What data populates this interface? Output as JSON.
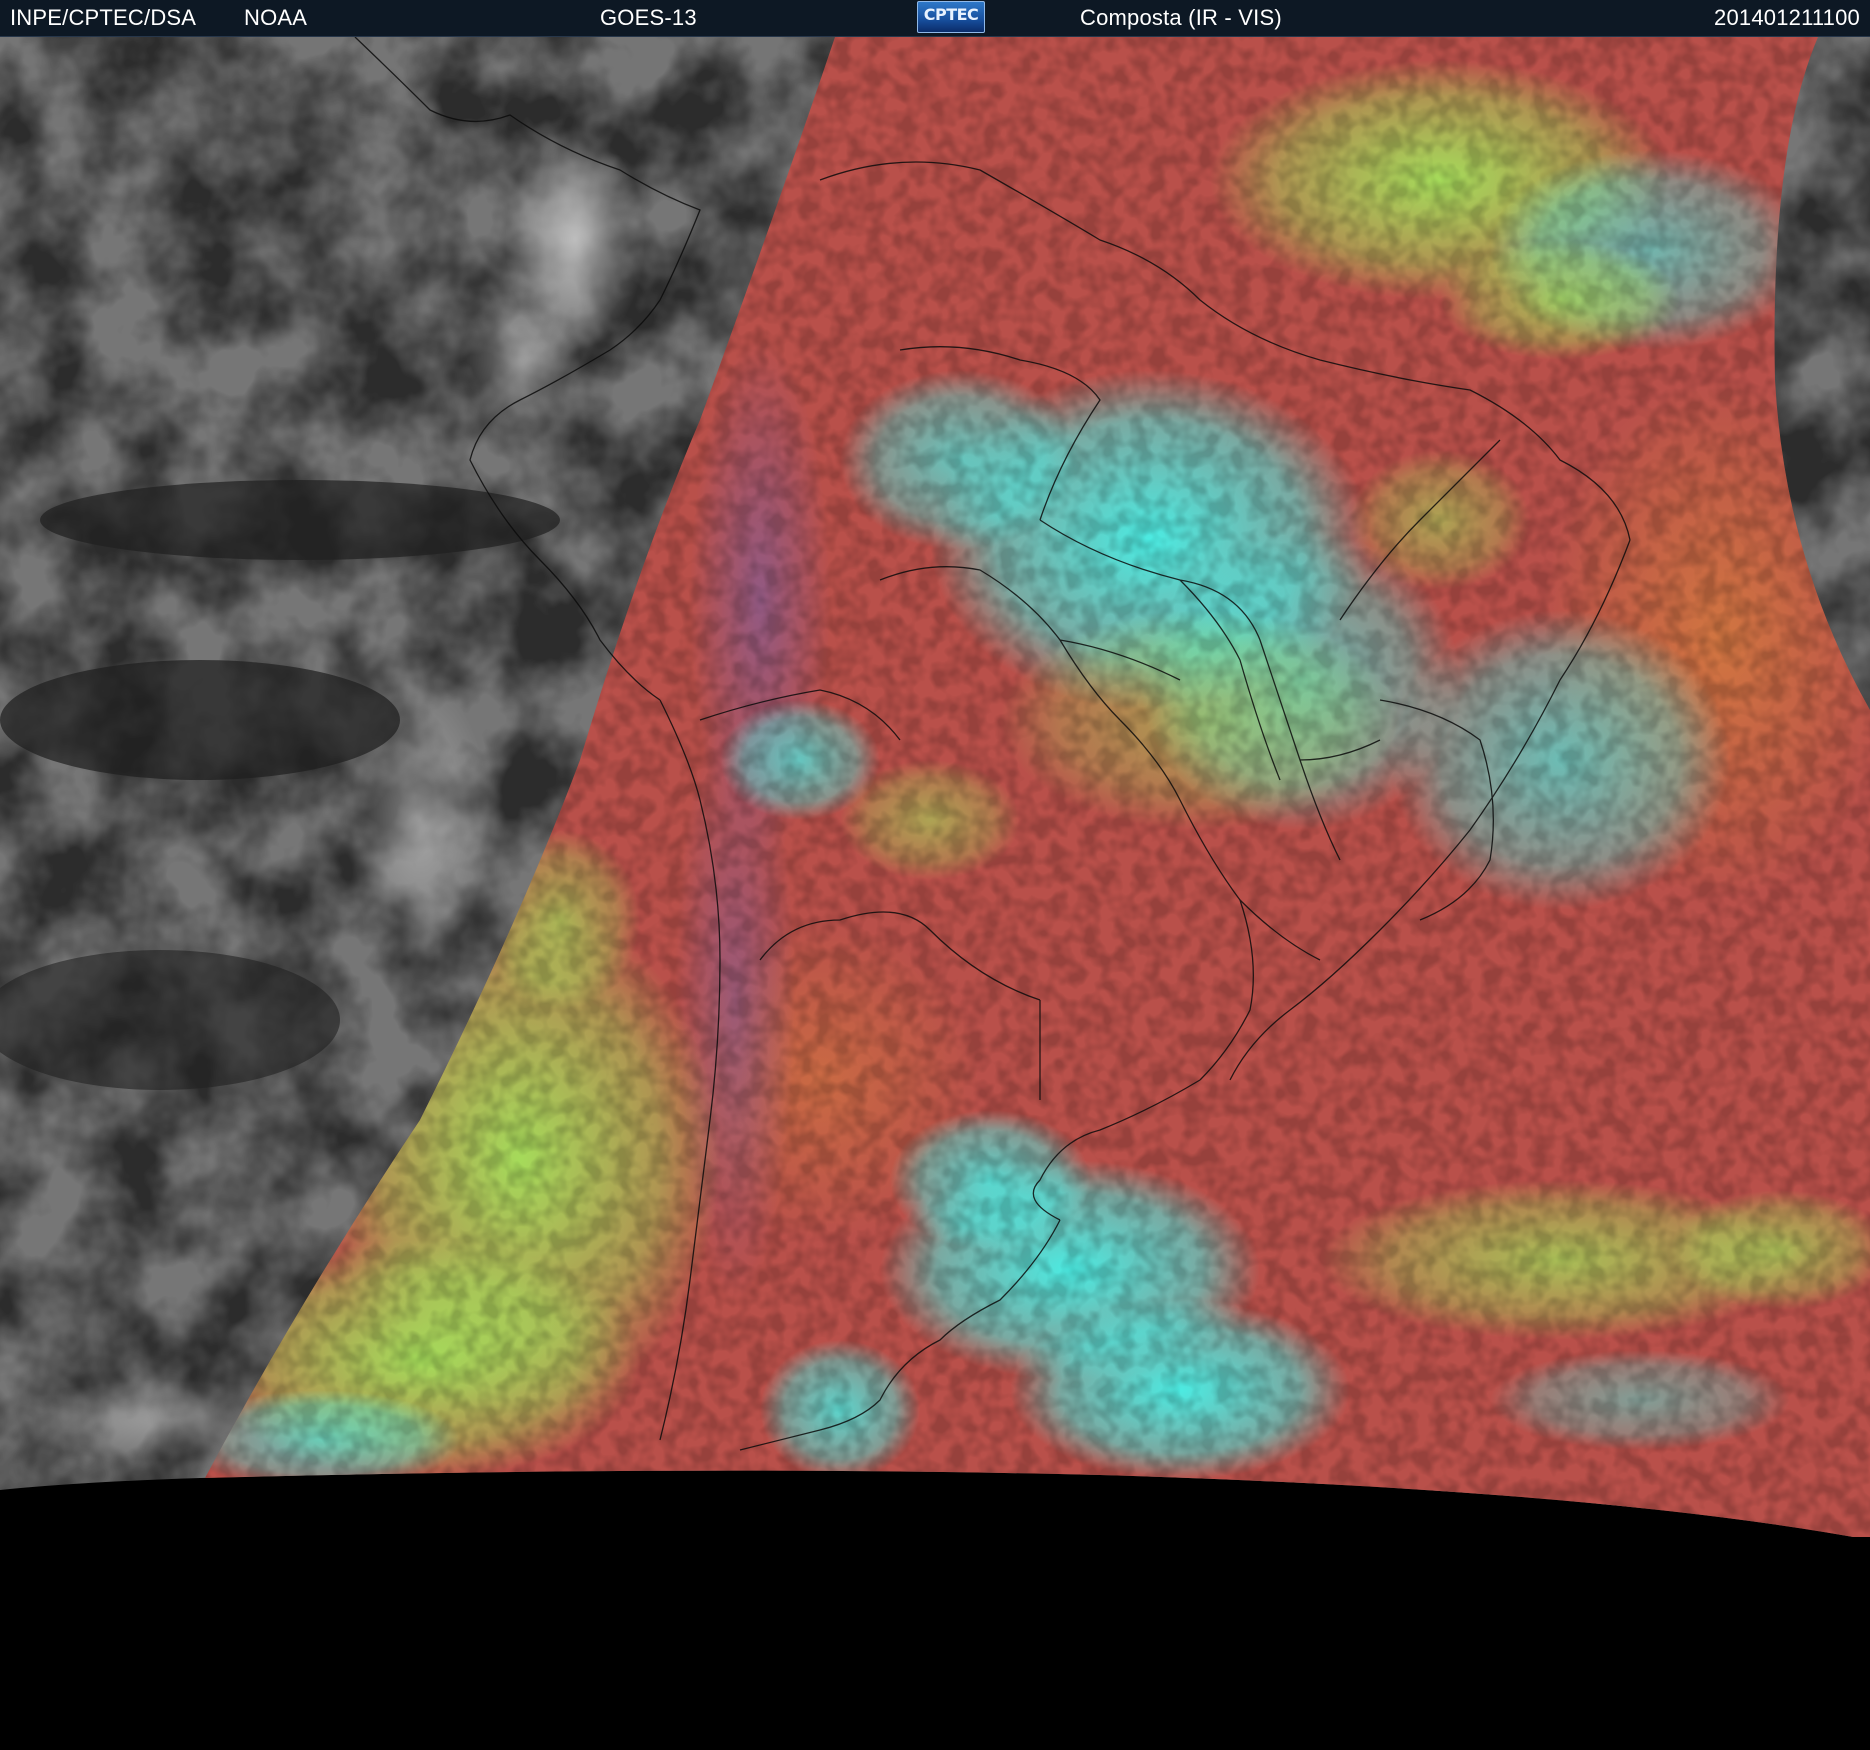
{
  "header": {
    "agency": "INPE/CPTEC/DSA",
    "source": "NOAA",
    "satellite": "GOES-13",
    "logo_text": "CPTEC",
    "product": "Composta (IR - VIS)",
    "timestamp": "201401211100"
  },
  "colors": {
    "header_bg": "#0d1824",
    "space": "#000000",
    "ir_dark": "#2b2b2b",
    "ir_clouds": "#9a9a9a",
    "composite_land": "#b9504a",
    "composite_cyan": "#3ff0e6",
    "composite_green": "#9ae65a",
    "composite_purple": "#8a5a86",
    "borders": "#101010"
  },
  "icons": {
    "logo": "cptec-logo"
  }
}
